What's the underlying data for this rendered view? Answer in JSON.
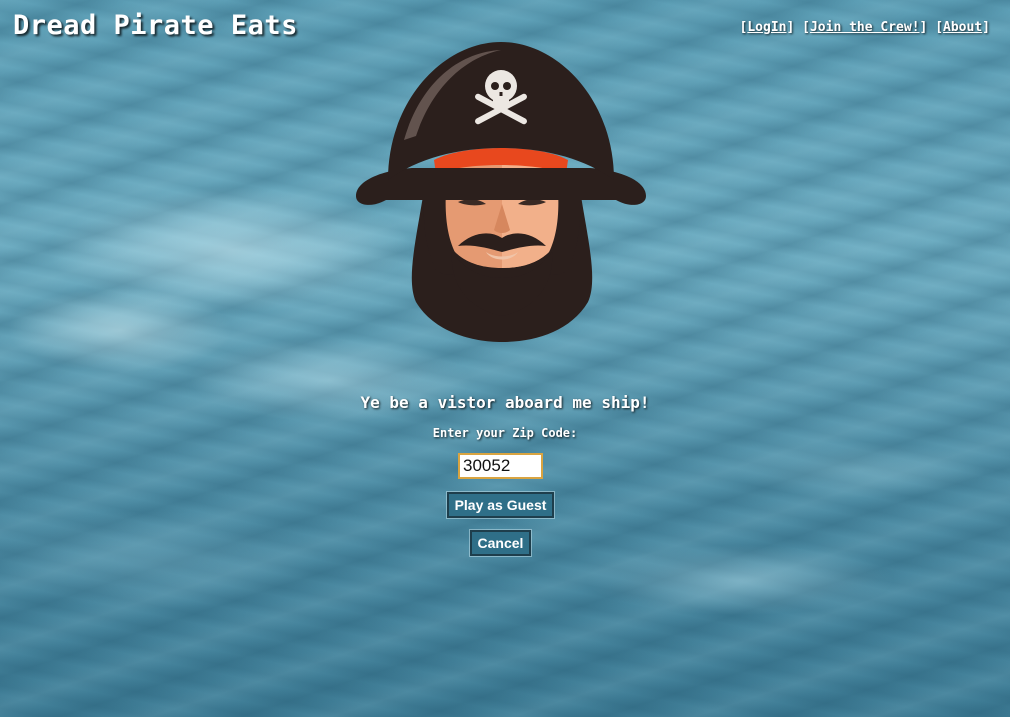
{
  "header": {
    "title": "Dread Pirate Eats",
    "nav": [
      {
        "label": "LogIn"
      },
      {
        "label": "Join the Crew!"
      },
      {
        "label": "About"
      }
    ]
  },
  "main": {
    "logo_icon": "pirate-captain-icon",
    "welcome_text": "Ye be a vistor aboard me ship!",
    "zip_label": "Enter your Zip Code:",
    "zip_value": "30052",
    "play_guest_label": "Play as Guest",
    "cancel_label": "Cancel"
  },
  "colors": {
    "sea": "#5d9fb6",
    "button_bg": "#2f6f88",
    "input_border": "#d9a441",
    "bandana": "#e8481e",
    "hat": "#2b1f1c"
  }
}
